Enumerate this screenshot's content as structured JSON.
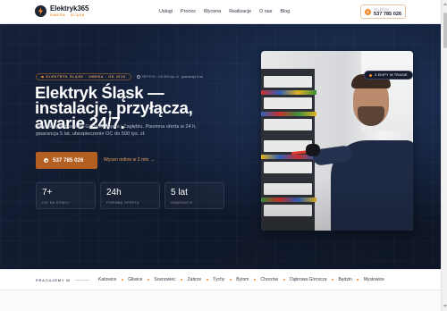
{
  "header": {
    "logo_name": "Elektryk365",
    "logo_sub": "OMEGA · ŚLĄSK",
    "nav": [
      "Usługi",
      "Proces",
      "Wycena",
      "Realizacje",
      "O nas",
      "Blog"
    ],
    "phone_label": "TELEFON",
    "phone_number": "537 785 026"
  },
  "hero": {
    "eyebrow": "ELEKTRYK ŚLĄSK · OMEGA · OD 2016",
    "eyebrow_note": "SEP E+D · OC 500 tys. zł · gwarancja 5 lat",
    "title": "Elektryk Śląsk — instalacje, przyłącza, awarie 24/7.",
    "description": "Trzy ekipy w trasie po Górnym Śląsku i Zagłębiu. Pisemna oferta w 24 h, gwarancja 5 lat, ubezpieczenie OC do 500 tys. zł.",
    "cta_primary": "537 785 026",
    "cta_secondary": "Wycen online w 2 min →",
    "stats": [
      {
        "value": "7+",
        "label": "LAT NA RYNKU"
      },
      {
        "value": "24h",
        "label": "PISEMNA OFERTA"
      },
      {
        "value": "5 lat",
        "label": "GWARANCJI"
      }
    ],
    "photo_badge": "3 EKIPY W TRASIE"
  },
  "cities": {
    "label": "PRACUJEMY W",
    "items": [
      "Katowice",
      "Gliwice",
      "Sosnowiec",
      "Zabrze",
      "Tychy",
      "Bytom",
      "Chorzów",
      "Dąbrowa Górnicza",
      "Będzin",
      "Mysłowice"
    ]
  },
  "colors": {
    "accent": "#f08a2b",
    "cta": "#b35f22",
    "hero_bg": "#111a2d"
  }
}
